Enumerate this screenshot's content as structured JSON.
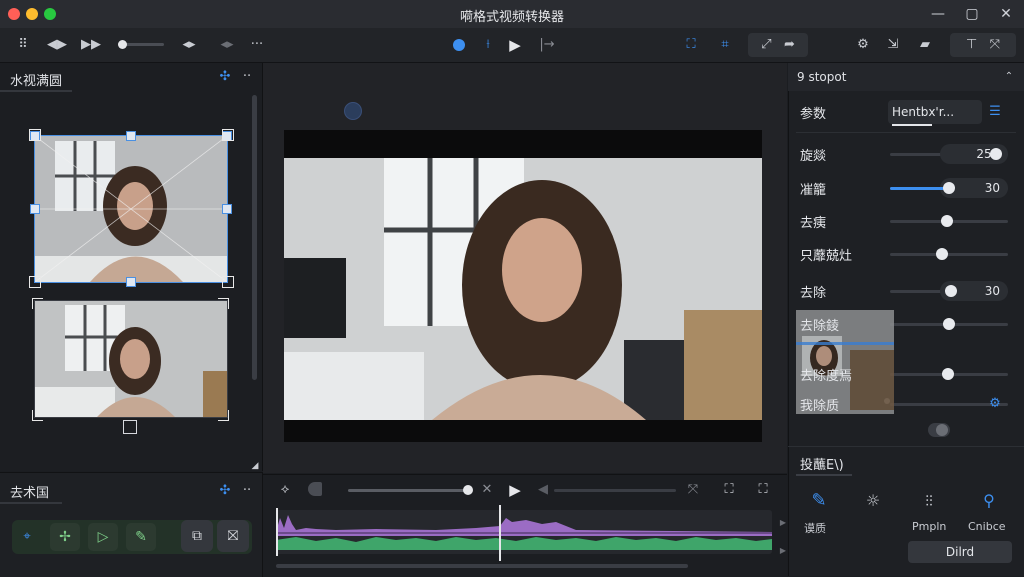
{
  "window": {
    "title": "嗬格式视频转换器"
  },
  "colors": {
    "accent": "#3d8ff0",
    "close": "#ff5f57",
    "minimize": "#febc2e",
    "maximize": "#28c840",
    "waveform_purple": "#9b6cc4",
    "waveform_green": "#3fa56a"
  },
  "left_panel": {
    "title": "水视满圆",
    "bottom_title": "去术国"
  },
  "right_panel": {
    "title": "9 stopot",
    "param_label": "参数",
    "param_value": "Hentbx'r...",
    "properties": [
      {
        "label": "旋燚",
        "value": "25C",
        "level": 0.9
      },
      {
        "label": "凗籠",
        "value": "30",
        "level": 0.5
      },
      {
        "label": "去痍",
        "value": "",
        "level": 0.48
      },
      {
        "label": "只蘼兢灶",
        "value": "",
        "level": 0.44
      },
      {
        "label": "去除",
        "value": "30",
        "level": 0.52
      },
      {
        "label": "去除錂",
        "value": "",
        "level": 0.5
      },
      {
        "label": "去除度焉",
        "value": "",
        "level": 0.49
      },
      {
        "label": "我除质",
        "value": "",
        "level": 0.0
      }
    ],
    "section_title": "投蘸E\\)",
    "tools": [
      {
        "label": "谟质",
        "icon": "pen-icon"
      },
      {
        "label": "",
        "icon": "sun-icon"
      },
      {
        "label": "Pmpln",
        "icon": "chart-icon"
      },
      {
        "label": "Cnibce",
        "icon": "pin-icon"
      }
    ],
    "apply_button": "Dilrd"
  }
}
